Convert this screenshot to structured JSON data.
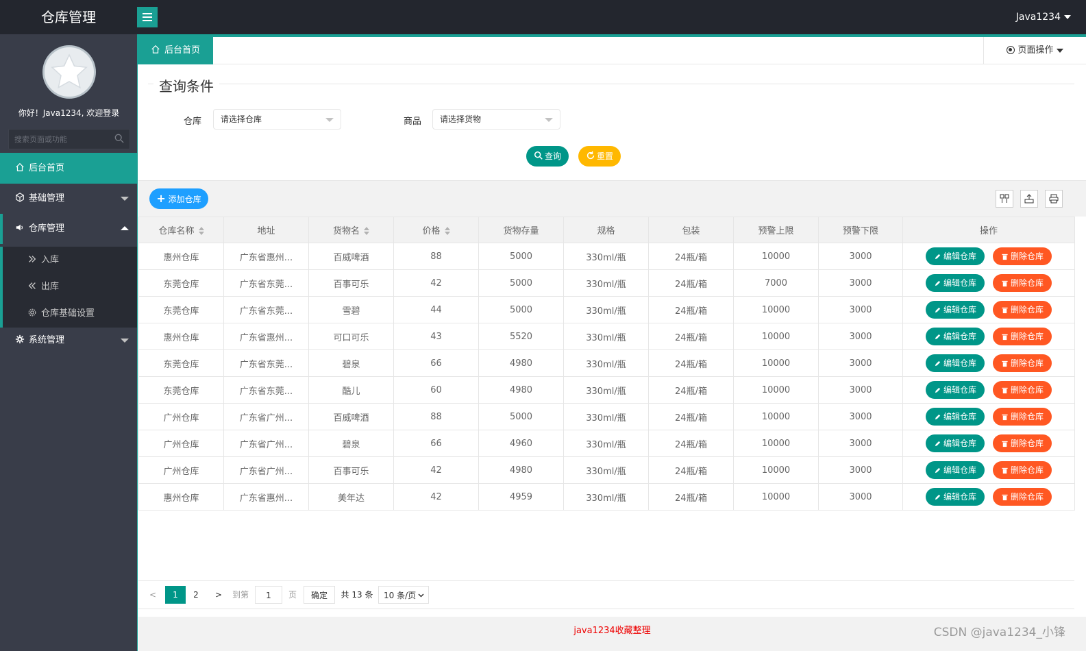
{
  "app": {
    "title": "仓库管理",
    "user": "Java1234"
  },
  "sidebar": {
    "welcome": "你好！Java1234, 欢迎登录",
    "search_placeholder": "搜索页面或功能",
    "home": "后台首页",
    "basic": "基础管理",
    "warehouse": "仓库管理",
    "sub_items": [
      "入库",
      "出库",
      "仓库基础设置"
    ],
    "system": "系统管理"
  },
  "tabs": {
    "home": "后台首页",
    "page_ops": "页面操作"
  },
  "query": {
    "legend": "查询条件",
    "warehouse_label": "仓库",
    "warehouse_value": "请选择仓库",
    "goods_label": "商品",
    "goods_value": "请选择货物",
    "search_btn": "查询",
    "reset_btn": "重置"
  },
  "toolbar": {
    "add": "添加仓库"
  },
  "table": {
    "headers": [
      "仓库名称",
      "地址",
      "货物名",
      "价格",
      "货物存量",
      "规格",
      "包装",
      "预警上限",
      "预警下限",
      "操作"
    ],
    "edit_label": "编辑仓库",
    "delete_label": "删除仓库",
    "rows": [
      [
        "惠州仓库",
        "广东省惠州...",
        "百威啤酒",
        "88",
        "5000",
        "330ml/瓶",
        "24瓶/箱",
        "10000",
        "3000"
      ],
      [
        "东莞仓库",
        "广东省东莞...",
        "百事可乐",
        "42",
        "5000",
        "330ml/瓶",
        "24瓶/箱",
        "7000",
        "3000"
      ],
      [
        "东莞仓库",
        "广东省东莞...",
        "雪碧",
        "44",
        "5000",
        "330ml/瓶",
        "24瓶/箱",
        "10000",
        "3000"
      ],
      [
        "惠州仓库",
        "广东省惠州...",
        "可口可乐",
        "43",
        "5520",
        "330ml/瓶",
        "24瓶/箱",
        "10000",
        "3000"
      ],
      [
        "东莞仓库",
        "广东省东莞...",
        "碧泉",
        "66",
        "4980",
        "330ml/瓶",
        "24瓶/箱",
        "10000",
        "3000"
      ],
      [
        "东莞仓库",
        "广东省东莞...",
        "酷儿",
        "60",
        "4980",
        "330ml/瓶",
        "24瓶/箱",
        "10000",
        "3000"
      ],
      [
        "广州仓库",
        "广东省广州...",
        "百威啤酒",
        "88",
        "5000",
        "330ml/瓶",
        "24瓶/箱",
        "10000",
        "3000"
      ],
      [
        "广州仓库",
        "广东省广州...",
        "碧泉",
        "66",
        "4960",
        "330ml/瓶",
        "24瓶/箱",
        "10000",
        "3000"
      ],
      [
        "广州仓库",
        "广东省广州...",
        "百事可乐",
        "42",
        "4980",
        "330ml/瓶",
        "24瓶/箱",
        "10000",
        "3000"
      ],
      [
        "惠州仓库",
        "广东省惠州...",
        "美年达",
        "42",
        "4959",
        "330ml/瓶",
        "24瓶/箱",
        "10000",
        "3000"
      ]
    ]
  },
  "pager": {
    "prev": "<",
    "page1": "1",
    "page2": "2",
    "next": ">",
    "goto": "到第",
    "page_input": "1",
    "page_unit": "页",
    "confirm": "确定",
    "total": "共 13 条",
    "size": "10 条/页"
  },
  "footer": {
    "text": "java1234收藏整理"
  },
  "watermark": "CSDN @java1234_小锋",
  "colors": {
    "accent": "#1aa094",
    "primary": "#009688",
    "warm": "#ffb800",
    "danger": "#ff5722",
    "blue": "#1e9fff",
    "header": "#23262e",
    "sidebar": "#393d49"
  }
}
